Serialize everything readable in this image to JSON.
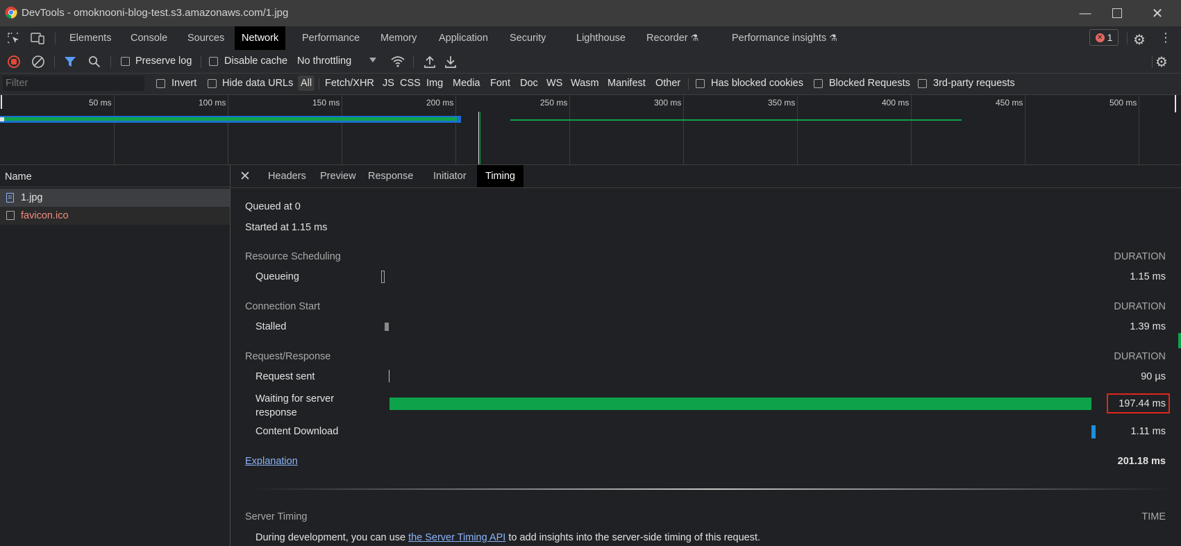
{
  "window": {
    "title": "DevTools - omoknooni-blog-test.s3.amazonaws.com/1.jpg"
  },
  "main_tabs": [
    {
      "label": "Elements"
    },
    {
      "label": "Console"
    },
    {
      "label": "Sources"
    },
    {
      "label": "Network",
      "active": true
    },
    {
      "label": "Performance"
    },
    {
      "label": "Memory"
    },
    {
      "label": "Application"
    },
    {
      "label": "Security"
    },
    {
      "label": "Lighthouse"
    },
    {
      "label": "Recorder"
    },
    {
      "label": "Performance insights"
    }
  ],
  "error_badge": {
    "count": "1"
  },
  "network_toolbar": {
    "preserve_log": "Preserve log",
    "disable_cache": "Disable cache",
    "throttling": "No throttling"
  },
  "filter_bar": {
    "placeholder": "Filter",
    "invert": "Invert",
    "hide_data_urls": "Hide data URLs",
    "types": [
      "All",
      "Fetch/XHR",
      "JS",
      "CSS",
      "Img",
      "Media",
      "Font",
      "Doc",
      "WS",
      "Wasm",
      "Manifest",
      "Other"
    ],
    "has_blocked_cookies": "Has blocked cookies",
    "blocked_requests": "Blocked Requests",
    "third_party": "3rd-party requests"
  },
  "overview": {
    "ticks": [
      "50 ms",
      "100 ms",
      "150 ms",
      "200 ms",
      "250 ms",
      "300 ms",
      "350 ms",
      "400 ms",
      "450 ms",
      "500 ms"
    ]
  },
  "request_list": {
    "header": "Name",
    "items": [
      {
        "name": "1.jpg"
      },
      {
        "name": "favicon.ico",
        "color": "#f28b82"
      }
    ]
  },
  "detail_tabs": [
    {
      "label": "Headers"
    },
    {
      "label": "Preview"
    },
    {
      "label": "Response"
    },
    {
      "label": "Initiator"
    },
    {
      "label": "Timing",
      "active": true
    }
  ],
  "timing": {
    "queued_at": "Queued at 0",
    "started_at": "Started at 1.15 ms",
    "duration_label": "DURATION",
    "sections": [
      {
        "title": "Resource Scheduling",
        "rows": [
          {
            "label": "Queueing",
            "value": "1.15 ms"
          }
        ]
      },
      {
        "title": "Connection Start",
        "rows": [
          {
            "label": "Stalled",
            "value": "1.39 ms"
          }
        ]
      },
      {
        "title": "Request/Response",
        "rows": [
          {
            "label": "Request sent",
            "value": "90 µs"
          },
          {
            "label": "Waiting for server response",
            "label_line1": "Waiting for server",
            "label_line2": "response",
            "value": "197.44 ms"
          },
          {
            "label": "Content Download",
            "value": "1.11 ms"
          }
        ]
      }
    ],
    "explanation": "Explanation",
    "total": "201.18 ms"
  },
  "server_timing": {
    "title": "Server Timing",
    "time_label": "TIME",
    "text_before": "During development, you can use ",
    "link": "the Server Timing API",
    "text_after": " to add insights into the server-side timing of this request."
  },
  "colors": {
    "waiting_bar": "#0ea34a",
    "download_bar": "#1a8fdb",
    "highlight_box": "#e0261f",
    "record_button": "#e34a3b"
  }
}
